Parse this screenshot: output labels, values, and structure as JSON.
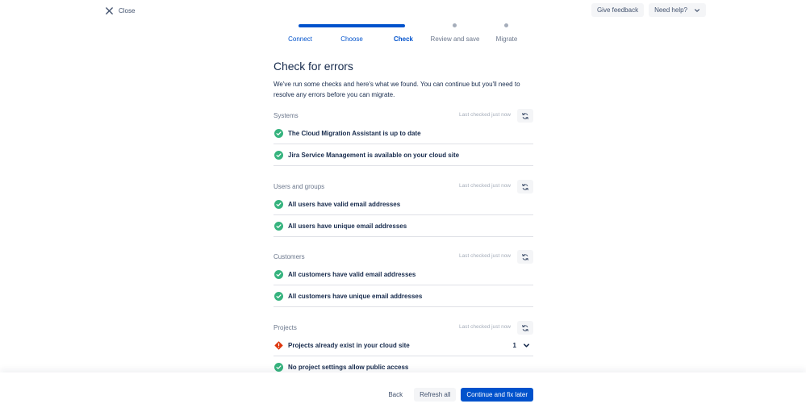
{
  "topbar": {
    "close_label": "Close",
    "give_feedback": "Give feedback",
    "need_help": "Need help?"
  },
  "steps": [
    {
      "label": "Connect",
      "state": "done"
    },
    {
      "label": "Choose",
      "state": "done"
    },
    {
      "label": "Check",
      "state": "current"
    },
    {
      "label": "Review and save",
      "state": "todo"
    },
    {
      "label": "Migrate",
      "state": "todo"
    }
  ],
  "page": {
    "title": "Check for errors",
    "description": "We've run some checks and here's what we found. You can continue but you'll need to resolve any errors before you can migrate."
  },
  "sections": [
    {
      "title": "Systems",
      "last_checked": "Last checked just now",
      "rows": [
        {
          "text": "The Cloud Migration Assistant is up to date",
          "status": "success"
        },
        {
          "text": "Jira Service Management is available on your cloud site",
          "status": "success"
        }
      ]
    },
    {
      "title": "Users and groups",
      "last_checked": "Last checked just now",
      "rows": [
        {
          "text": "All users have valid email addresses",
          "status": "success"
        },
        {
          "text": "All users have unique email addresses",
          "status": "success"
        }
      ]
    },
    {
      "title": "Customers",
      "last_checked": "Last checked just now",
      "rows": [
        {
          "text": "All customers have valid email addresses",
          "status": "success"
        },
        {
          "text": "All customers have unique email addresses",
          "status": "success"
        }
      ]
    },
    {
      "title": "Projects",
      "last_checked": "Last checked just now",
      "rows": [
        {
          "text": "Projects already exist in your cloud site",
          "status": "error",
          "count": "1"
        },
        {
          "text": "No project settings allow public access",
          "status": "success"
        }
      ]
    }
  ],
  "footer": {
    "back": "Back",
    "refresh_all": "Refresh all",
    "continue": "Continue and fix later"
  },
  "colors": {
    "primary": "#0052CC",
    "success": "#36B37E",
    "error": "#DE350B",
    "text": "#172B4D",
    "subtle_bg": "#F4F5F7"
  },
  "icons": {
    "close": "close-icon",
    "chevron": "chevron-down-icon",
    "refresh": "refresh-icon",
    "success": "check-circle-icon",
    "error": "error-diamond-icon"
  }
}
